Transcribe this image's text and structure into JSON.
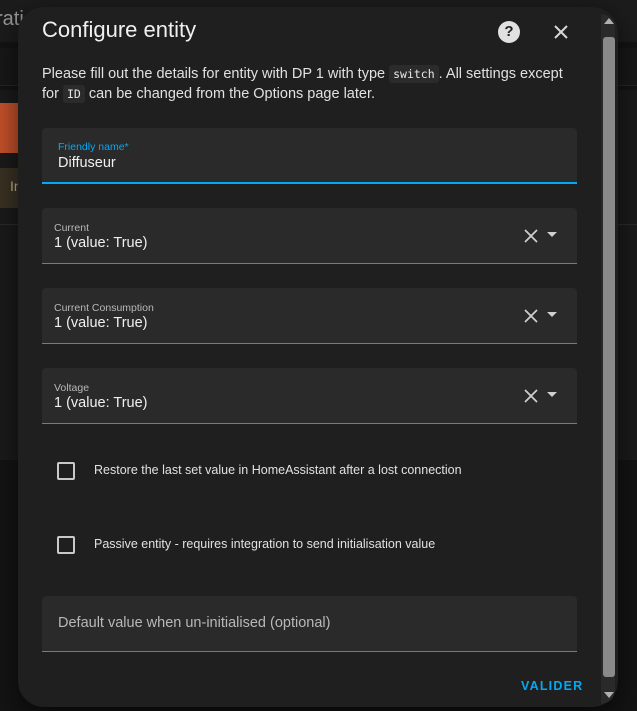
{
  "background": {
    "title_fragment": "rati",
    "button_fragment": "In"
  },
  "dialog": {
    "title": "Configure entity",
    "help_icon": "help-circle-icon",
    "close_icon": "close-icon",
    "description": {
      "part1": "Please fill out the details for entity with DP 1 with type ",
      "code1": "switch",
      "part2": ". All settings except for ",
      "code2": "ID",
      "part3": " can be changed from the Options page later."
    },
    "fields": {
      "friendly_name": {
        "label": "Friendly name*",
        "value": "Diffuseur"
      },
      "current": {
        "label": "Current",
        "value": "1 (value: True)"
      },
      "current_consumption": {
        "label": "Current Consumption",
        "value": "1 (value: True)"
      },
      "voltage": {
        "label": "Voltage",
        "value": "1 (value: True)"
      },
      "default_value": {
        "placeholder": "Default value when un-initialised (optional)"
      }
    },
    "checkboxes": {
      "restore": {
        "label": "Restore the last set value in HomeAssistant after a lost connection",
        "checked": false
      },
      "passive": {
        "label": "Passive entity - requires integration to send initialisation value",
        "checked": false
      }
    },
    "submit_label": "VALIDER"
  },
  "colors": {
    "accent": "#03a9f4",
    "dialog_bg": "#1f1f1f",
    "field_bg": "#2a2a2a"
  }
}
